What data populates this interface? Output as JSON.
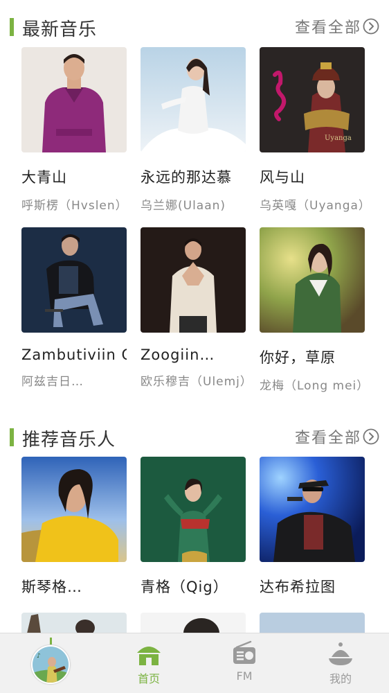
{
  "latest": {
    "title": "最新音乐",
    "more_label": "查看全部",
    "songs": [
      {
        "name": "大青山",
        "artist": "呼斯楞（Hvslen）"
      },
      {
        "name": "永远的那达慕",
        "artist": "乌兰娜(Ulaan)"
      },
      {
        "name": "风与山",
        "artist": "乌英嘎（Uyanga）"
      },
      {
        "name": "Zambutiviin Ge…",
        "artist": "阿兹吉日…"
      },
      {
        "name": "Zoogiin…",
        "artist": "欧乐穆吉（Ulemj）"
      },
      {
        "name": "你好，草原",
        "artist": "龙梅（Long mei）"
      }
    ]
  },
  "recommended": {
    "title": "推荐音乐人",
    "more_label": "查看全部",
    "artists": [
      {
        "name": "斯琴格…"
      },
      {
        "name": "青格（Qig）"
      },
      {
        "name": "达布希拉图"
      }
    ]
  },
  "tabbar": {
    "tabs": [
      {
        "label": "首页",
        "icon": "home-icon",
        "active": true
      },
      {
        "label": "FM",
        "icon": "radio-icon",
        "active": false
      },
      {
        "label": "我的",
        "icon": "profile-icon",
        "active": false
      }
    ]
  },
  "colors": {
    "accent": "#7cb342",
    "inactive": "#9a9a9a"
  }
}
